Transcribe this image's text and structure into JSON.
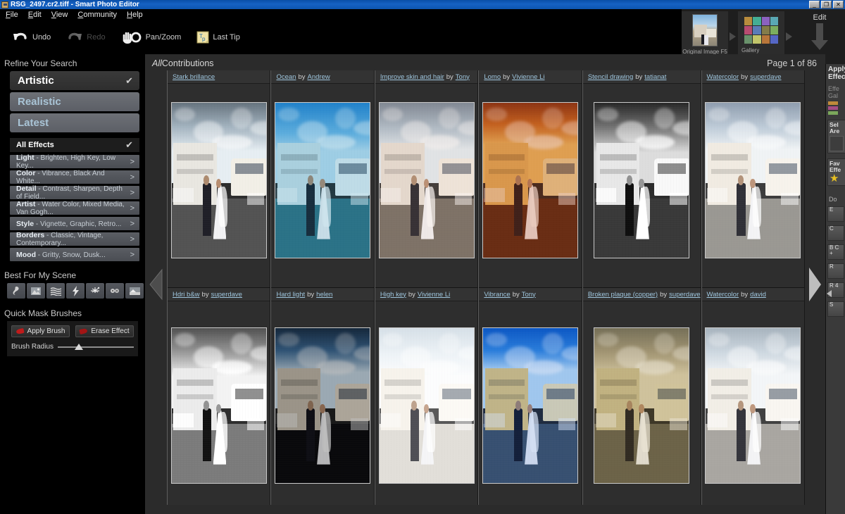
{
  "window": {
    "title": "RSG_2497.cr2.tiff - Smart Photo Editor",
    "minimize_label": "_",
    "restore_label": "❐",
    "close_label": "✕",
    "app_icon": "photo-file-icon"
  },
  "menu": {
    "items": [
      {
        "label": "File",
        "mnemonic": "F",
        "rest": "ile"
      },
      {
        "label": "Edit",
        "mnemonic": "E",
        "rest": "dit"
      },
      {
        "label": "View",
        "mnemonic": "V",
        "rest": "iew"
      },
      {
        "label": "Community",
        "mnemonic": "C",
        "rest": "ommunity"
      },
      {
        "label": "Help",
        "mnemonic": "H",
        "rest": "elp"
      }
    ]
  },
  "toolbar": {
    "undo": "Undo",
    "redo": "Redo",
    "panzoom": "Pan/Zoom",
    "lasttip": "Last Tip"
  },
  "workflow": {
    "original_caption": "Original Image F5",
    "gallery_caption": "Gallery",
    "edit_label": "Edit",
    "gallery_swatches": [
      "#b98c3d",
      "#44ae94",
      "#8b62c0",
      "#5aa8b4",
      "#b84c70",
      "#5a7cb8",
      "#837c4a",
      "#7cae5e",
      "#69926b",
      "#c2c56a",
      "#b8763a",
      "#5566c4"
    ]
  },
  "sidebar": {
    "refine_heading": "Refine Your Search",
    "style_pills": [
      {
        "label": "Artistic",
        "selected": true
      },
      {
        "label": "Realistic",
        "selected": false
      },
      {
        "label": "Latest",
        "selected": false
      }
    ],
    "all_effects": {
      "label": "All Effects",
      "selected": true
    },
    "categories": [
      {
        "name": "Light",
        "desc": "- Brighten, High Key, Low Key...",
        "chevron": ">"
      },
      {
        "name": "Color",
        "desc": "- Vibrance, Black And White...",
        "chevron": ">"
      },
      {
        "name": "Detail",
        "desc": "- Contrast, Sharpen, Depth of Field...",
        "chevron": ">"
      },
      {
        "name": "Artist",
        "desc": "- Water Color, Mixed Media, Van Gogh...",
        "chevron": ">"
      },
      {
        "name": "Style",
        "desc": "- Vignette, Graphic, Retro...",
        "chevron": ">"
      },
      {
        "name": "Borders",
        "desc": "- Classic, Vintage, Contemporary...",
        "chevron": ">"
      },
      {
        "name": "Mood",
        "desc": "- Gritty, Snow, Dusk...",
        "chevron": ">"
      }
    ],
    "best_scene_heading": "Best For My Scene",
    "scene_icons": [
      "flower-swirl-icon",
      "landscape-icon",
      "water-waves-icon",
      "lightning-icon",
      "fireworks-icon",
      "flowers-icon",
      "sunset-icon"
    ],
    "quick_mask_heading": "Quick Mask Brushes",
    "apply_brush": "Apply Brush",
    "erase_effect": "Erase Effect",
    "brush_radius_label": "Brush Radius",
    "brush_radius_value": 22
  },
  "main": {
    "title_prefix": "All",
    "title_rest": "Contributions",
    "page_indicator": "Page 1 of 86",
    "prev_arrow": "prev-page-arrow",
    "next_arrow": "next-page-arrow",
    "rows": [
      [
        {
          "effect": "Stark brillance",
          "by": "",
          "author": "",
          "style": "stark"
        },
        {
          "effect": "Ocean",
          "by": "by",
          "author": "Andrew",
          "style": "ocean"
        },
        {
          "effect": "Improve skin and hair",
          "by": "by",
          "author": "Tony",
          "style": "skin"
        },
        {
          "effect": "Lomo",
          "by": "by",
          "author": "Vivienne Li",
          "style": "lomo"
        },
        {
          "effect": "Stencil drawing",
          "by": "by",
          "author": "tatianat",
          "style": "stencil"
        },
        {
          "effect": "Watercolor",
          "by": "by",
          "author": "superdave",
          "style": "watercolor1"
        }
      ],
      [
        {
          "effect": "Hdri b&w",
          "by": "by",
          "author": "superdave",
          "style": "hdribw"
        },
        {
          "effect": "Hard light",
          "by": "by",
          "author": "helen",
          "style": "hardlight"
        },
        {
          "effect": "High key",
          "by": "by",
          "author": "Vivienne Li",
          "style": "highkey"
        },
        {
          "effect": "Vibrance",
          "by": "by",
          "author": "Tony",
          "style": "vibrance"
        },
        {
          "effect": "Broken plaque (copper)",
          "by": "by",
          "author": "superdave",
          "style": "plaque"
        },
        {
          "effect": "Watercolor",
          "by": "by",
          "author": "david",
          "style": "watercolor2"
        }
      ]
    ]
  },
  "right_panel": {
    "apply_effects_line1": "Apply",
    "apply_effects_line2": "Effects",
    "effects_gallery_line1": "Effe",
    "effects_gallery_line2": "Gal",
    "swatches": [
      "#c08a3a",
      "#a64d85",
      "#7ba75b"
    ],
    "select_area_line1": "Sel",
    "select_area_line2": "Are",
    "favorite_line1": "Fav",
    "favorite_line2": "Effe",
    "star_glyph": "★",
    "download_label": "Do",
    "buttons": [
      "E",
      "C",
      "B C +",
      "R",
      "R 4",
      "S"
    ]
  },
  "colors": {
    "titlebar_blue": "#1662c4",
    "accent_link": "#9fc6de",
    "panel_bg": "#2b2b2b",
    "sidebar_bg": "#000000"
  }
}
